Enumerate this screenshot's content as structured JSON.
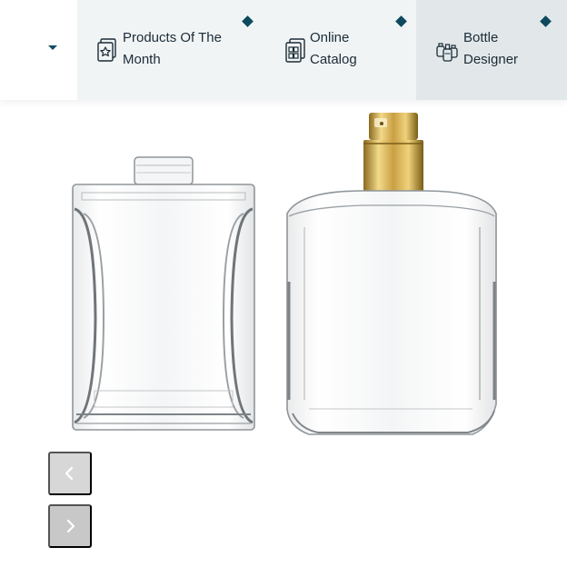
{
  "nav": {
    "items": [
      {
        "line1": "Products Of The",
        "line2": "Month",
        "icon": "star-card-icon"
      },
      {
        "line1": "Online",
        "line2": "Catalog",
        "icon": "catalog-icon"
      },
      {
        "line1": "Bottle",
        "line2": "Designer",
        "icon": "bottle-designer-icon"
      }
    ],
    "dropdown_icon": "caret-down-icon",
    "accent_color": "#0d4a5e",
    "active_item": "Bottle Designer"
  },
  "gallery": {
    "images": [
      "clear-glass-bottle-neck",
      "clear-glass-bottle-with-gold-sprayer"
    ],
    "prev_icon": "chevron-left-icon",
    "next_icon": "chevron-right-icon",
    "prev_enabled": false,
    "next_enabled": true
  }
}
